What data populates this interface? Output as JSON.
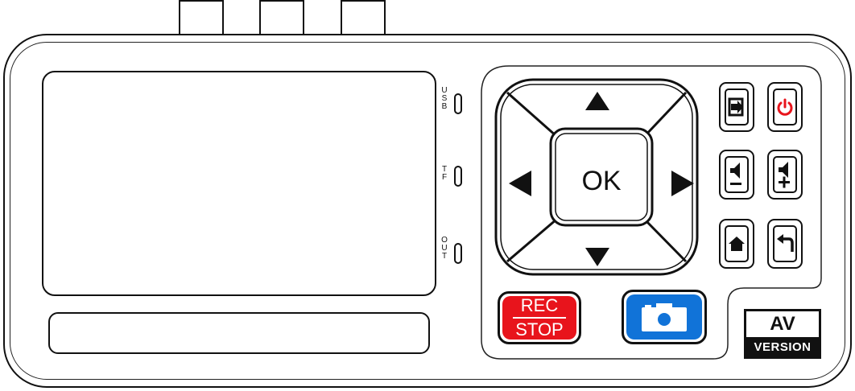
{
  "device": {
    "screen_label": "",
    "slots": [
      {
        "label": "USB",
        "letters": [
          "U",
          "S",
          "B"
        ]
      },
      {
        "label": "TF",
        "letters": [
          "T",
          "F"
        ]
      },
      {
        "label": "OUT",
        "letters": [
          "O",
          "U",
          "T"
        ]
      }
    ]
  },
  "dpad": {
    "ok_label": "OK",
    "up_icon": "▲",
    "down_icon": "▼",
    "left_icon": "◀",
    "right_icon": "▶"
  },
  "buttons": {
    "input": {
      "icon": "input-arrow-icon"
    },
    "power": {
      "icon": "power-icon",
      "color": "#e8141c"
    },
    "volume_down": {
      "icon": "speaker-icon",
      "symbol": "−"
    },
    "volume_up": {
      "icon": "speaker-icon",
      "symbol": "+"
    },
    "home": {
      "icon": "home-icon"
    },
    "back": {
      "icon": "back-arrow-icon"
    }
  },
  "rec_stop": {
    "top": "REC",
    "bottom": "STOP",
    "color": "#e8141c"
  },
  "snapshot": {
    "icon": "camera-icon",
    "color": "#1173d8"
  },
  "badge": {
    "top": "AV",
    "bottom": "VERSION"
  }
}
